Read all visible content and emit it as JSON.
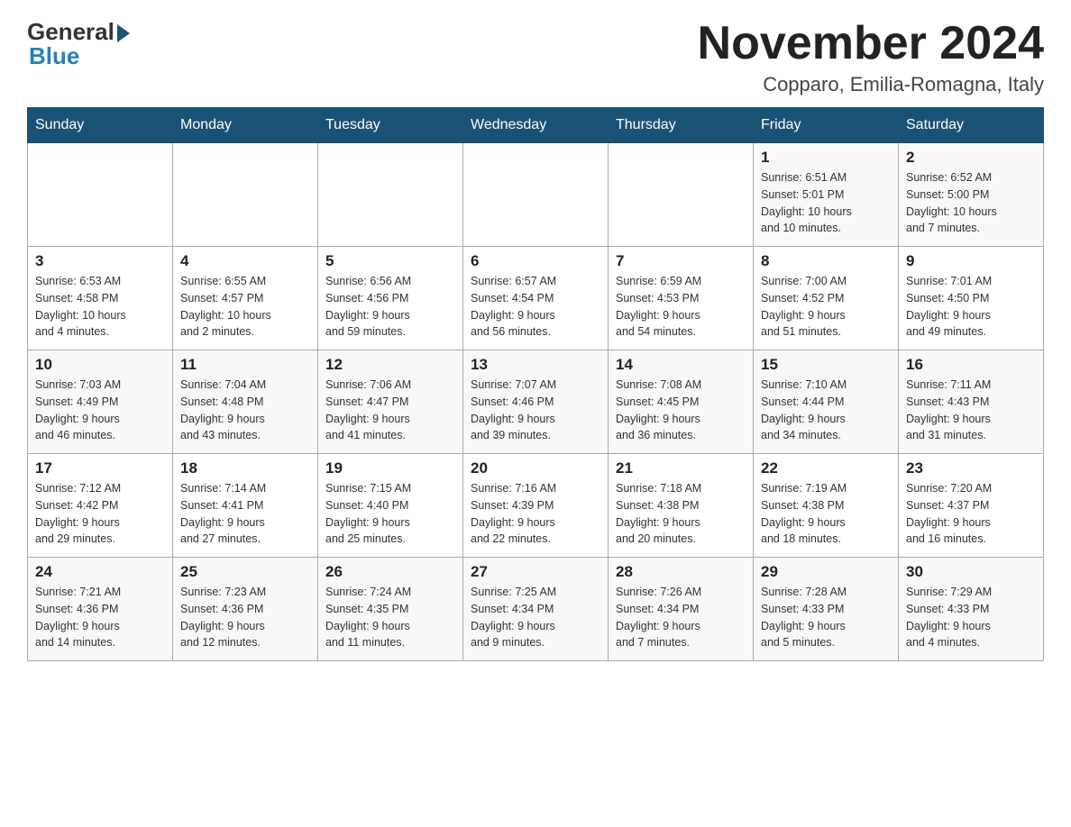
{
  "header": {
    "logo_general": "General",
    "logo_blue": "Blue",
    "month_title": "November 2024",
    "location": "Copparo, Emilia-Romagna, Italy"
  },
  "weekdays": [
    "Sunday",
    "Monday",
    "Tuesday",
    "Wednesday",
    "Thursday",
    "Friday",
    "Saturday"
  ],
  "weeks": [
    [
      {
        "day": "",
        "info": ""
      },
      {
        "day": "",
        "info": ""
      },
      {
        "day": "",
        "info": ""
      },
      {
        "day": "",
        "info": ""
      },
      {
        "day": "",
        "info": ""
      },
      {
        "day": "1",
        "info": "Sunrise: 6:51 AM\nSunset: 5:01 PM\nDaylight: 10 hours\nand 10 minutes."
      },
      {
        "day": "2",
        "info": "Sunrise: 6:52 AM\nSunset: 5:00 PM\nDaylight: 10 hours\nand 7 minutes."
      }
    ],
    [
      {
        "day": "3",
        "info": "Sunrise: 6:53 AM\nSunset: 4:58 PM\nDaylight: 10 hours\nand 4 minutes."
      },
      {
        "day": "4",
        "info": "Sunrise: 6:55 AM\nSunset: 4:57 PM\nDaylight: 10 hours\nand 2 minutes."
      },
      {
        "day": "5",
        "info": "Sunrise: 6:56 AM\nSunset: 4:56 PM\nDaylight: 9 hours\nand 59 minutes."
      },
      {
        "day": "6",
        "info": "Sunrise: 6:57 AM\nSunset: 4:54 PM\nDaylight: 9 hours\nand 56 minutes."
      },
      {
        "day": "7",
        "info": "Sunrise: 6:59 AM\nSunset: 4:53 PM\nDaylight: 9 hours\nand 54 minutes."
      },
      {
        "day": "8",
        "info": "Sunrise: 7:00 AM\nSunset: 4:52 PM\nDaylight: 9 hours\nand 51 minutes."
      },
      {
        "day": "9",
        "info": "Sunrise: 7:01 AM\nSunset: 4:50 PM\nDaylight: 9 hours\nand 49 minutes."
      }
    ],
    [
      {
        "day": "10",
        "info": "Sunrise: 7:03 AM\nSunset: 4:49 PM\nDaylight: 9 hours\nand 46 minutes."
      },
      {
        "day": "11",
        "info": "Sunrise: 7:04 AM\nSunset: 4:48 PM\nDaylight: 9 hours\nand 43 minutes."
      },
      {
        "day": "12",
        "info": "Sunrise: 7:06 AM\nSunset: 4:47 PM\nDaylight: 9 hours\nand 41 minutes."
      },
      {
        "day": "13",
        "info": "Sunrise: 7:07 AM\nSunset: 4:46 PM\nDaylight: 9 hours\nand 39 minutes."
      },
      {
        "day": "14",
        "info": "Sunrise: 7:08 AM\nSunset: 4:45 PM\nDaylight: 9 hours\nand 36 minutes."
      },
      {
        "day": "15",
        "info": "Sunrise: 7:10 AM\nSunset: 4:44 PM\nDaylight: 9 hours\nand 34 minutes."
      },
      {
        "day": "16",
        "info": "Sunrise: 7:11 AM\nSunset: 4:43 PM\nDaylight: 9 hours\nand 31 minutes."
      }
    ],
    [
      {
        "day": "17",
        "info": "Sunrise: 7:12 AM\nSunset: 4:42 PM\nDaylight: 9 hours\nand 29 minutes."
      },
      {
        "day": "18",
        "info": "Sunrise: 7:14 AM\nSunset: 4:41 PM\nDaylight: 9 hours\nand 27 minutes."
      },
      {
        "day": "19",
        "info": "Sunrise: 7:15 AM\nSunset: 4:40 PM\nDaylight: 9 hours\nand 25 minutes."
      },
      {
        "day": "20",
        "info": "Sunrise: 7:16 AM\nSunset: 4:39 PM\nDaylight: 9 hours\nand 22 minutes."
      },
      {
        "day": "21",
        "info": "Sunrise: 7:18 AM\nSunset: 4:38 PM\nDaylight: 9 hours\nand 20 minutes."
      },
      {
        "day": "22",
        "info": "Sunrise: 7:19 AM\nSunset: 4:38 PM\nDaylight: 9 hours\nand 18 minutes."
      },
      {
        "day": "23",
        "info": "Sunrise: 7:20 AM\nSunset: 4:37 PM\nDaylight: 9 hours\nand 16 minutes."
      }
    ],
    [
      {
        "day": "24",
        "info": "Sunrise: 7:21 AM\nSunset: 4:36 PM\nDaylight: 9 hours\nand 14 minutes."
      },
      {
        "day": "25",
        "info": "Sunrise: 7:23 AM\nSunset: 4:36 PM\nDaylight: 9 hours\nand 12 minutes."
      },
      {
        "day": "26",
        "info": "Sunrise: 7:24 AM\nSunset: 4:35 PM\nDaylight: 9 hours\nand 11 minutes."
      },
      {
        "day": "27",
        "info": "Sunrise: 7:25 AM\nSunset: 4:34 PM\nDaylight: 9 hours\nand 9 minutes."
      },
      {
        "day": "28",
        "info": "Sunrise: 7:26 AM\nSunset: 4:34 PM\nDaylight: 9 hours\nand 7 minutes."
      },
      {
        "day": "29",
        "info": "Sunrise: 7:28 AM\nSunset: 4:33 PM\nDaylight: 9 hours\nand 5 minutes."
      },
      {
        "day": "30",
        "info": "Sunrise: 7:29 AM\nSunset: 4:33 PM\nDaylight: 9 hours\nand 4 minutes."
      }
    ]
  ]
}
